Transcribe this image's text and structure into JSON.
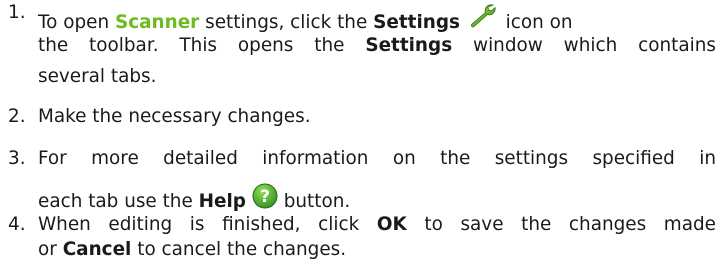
{
  "steps": [
    {
      "number": "1.",
      "text_1": "To open",
      "scanner": "Scanner",
      "text_2": "settings, click the",
      "settings_1": "Settings",
      "icon": "wrench-icon",
      "text_3": "icon on",
      "line_2": "the toolbar. This opens the",
      "settings_2": "Settings",
      "text_4": "window which contains",
      "line_3": "several tabs."
    },
    {
      "number": "2.",
      "text": "Make the necessary changes."
    },
    {
      "number": "3.",
      "line_1": "For more detailed information on the settings specified in",
      "text_1": "each tab use the",
      "help": "Help",
      "icon": "help-icon",
      "text_2": "button."
    },
    {
      "number": "4.",
      "text_1": "When editing is finished, click",
      "ok": "OK",
      "text_2": "to save the changes made",
      "text_3": "or",
      "cancel": "Cancel",
      "text_4": "to cancel the changes."
    }
  ],
  "colors": {
    "text": "#1a1a1a",
    "link_green": "#6dbb1f",
    "help_icon_green": "#3fa12b"
  }
}
